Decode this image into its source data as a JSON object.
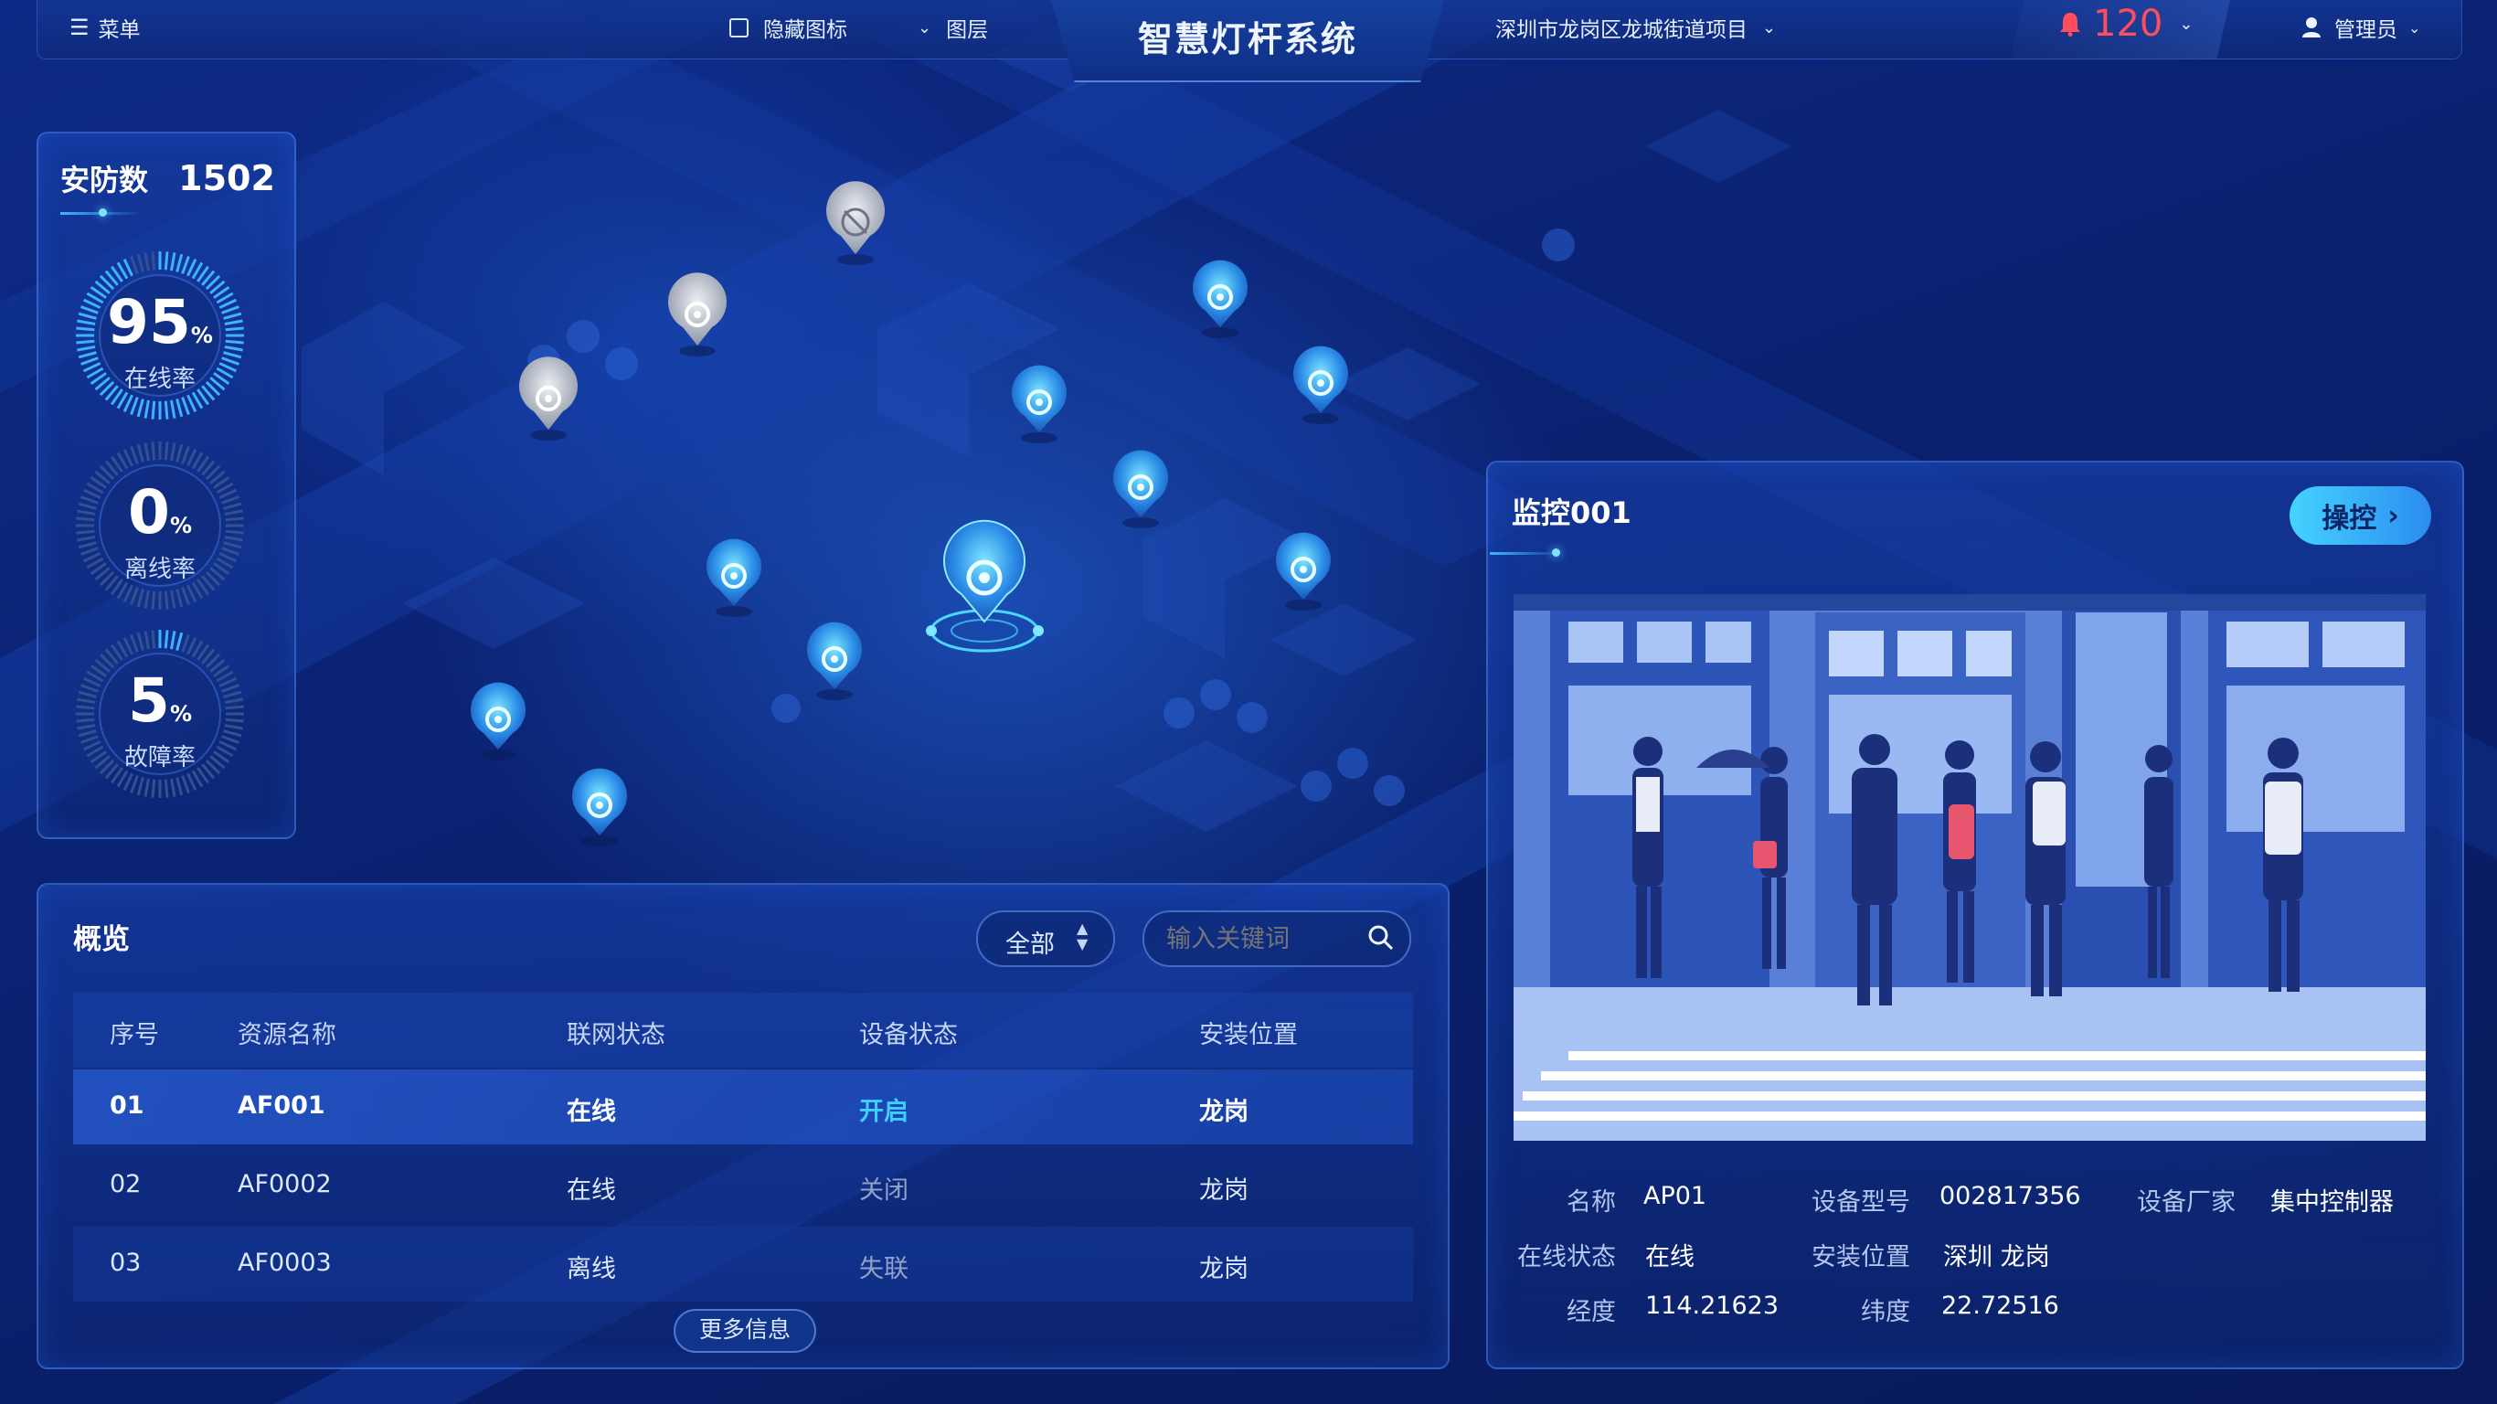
{
  "topbar": {
    "menu_label": "菜单",
    "hide_icons_label": "隐藏图标",
    "hide_icons_checked": false,
    "layers_label": "图层",
    "title": "智慧灯杆系统",
    "project_label": "深圳市龙岗区龙城街道项目",
    "alarm_count": "120",
    "user_label": "管理员"
  },
  "stats": {
    "title": "安防数",
    "count": "1502",
    "gauges": [
      {
        "value": "95",
        "unit": "%",
        "label": "在线率",
        "percent": 95
      },
      {
        "value": "0",
        "unit": "%",
        "label": "离线率",
        "percent": 0
      },
      {
        "value": "5",
        "unit": "%",
        "label": "故障率",
        "percent": 5
      }
    ]
  },
  "overview": {
    "title": "概览",
    "filter_value": "全部",
    "search_placeholder": "输入关键词",
    "columns": [
      "序号",
      "资源名称",
      "联网状态",
      "设备状态",
      "安装位置"
    ],
    "rows": [
      {
        "index": "01",
        "name": "AF001",
        "network": "在线",
        "device": "开启",
        "location": "龙岗"
      },
      {
        "index": "02",
        "name": "AF0002",
        "network": "在线",
        "device": "关闭",
        "location": "龙岗"
      },
      {
        "index": "03",
        "name": "AF0003",
        "network": "离线",
        "device": "失联",
        "location": "龙岗"
      }
    ],
    "more_label": "更多信息"
  },
  "monitor": {
    "title": "监控001",
    "control_label": "操控",
    "info": {
      "name_label": "名称",
      "name_value": "AP01",
      "model_label": "设备型号",
      "model_value": "002817356",
      "vendor_label": "设备厂家",
      "vendor_value": "集中控制器",
      "status_label": "在线状态",
      "status_value": "在线",
      "location_label": "安装位置",
      "location_value": "深圳 龙岗",
      "lng_label": "经度",
      "lng_value": "114.21623",
      "lat_label": "纬度",
      "lat_value": "22.72516"
    }
  },
  "colors": {
    "accent": "#3fc6ff",
    "alarm": "#ff4d5e",
    "device_on": "#3fd0ff",
    "device_off": "#8fa3c9",
    "offline_pin": "#b9bfca"
  }
}
